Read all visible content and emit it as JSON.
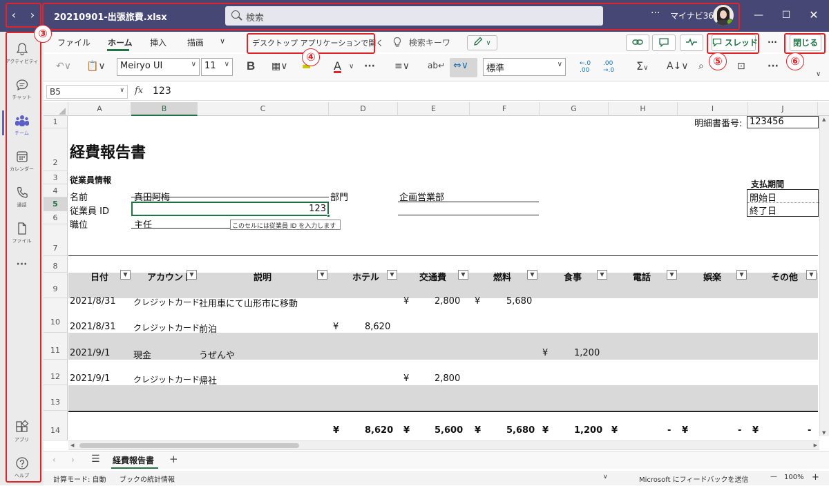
{
  "titlebar": {
    "file_name": "20210901-出張旅費.xlsx",
    "search_placeholder": "検索",
    "more": "···",
    "org": "マイナビ365"
  },
  "callouts": [
    "③",
    "④",
    "⑤",
    "⑥"
  ],
  "rail": [
    {
      "label": "アクティビティ",
      "icon": "bell-icon"
    },
    {
      "label": "チャット",
      "icon": "chat-icon"
    },
    {
      "label": "チーム",
      "icon": "teams-icon",
      "active": true
    },
    {
      "label": "カレンダー",
      "icon": "calendar-icon"
    },
    {
      "label": "通話",
      "icon": "phone-icon"
    },
    {
      "label": "ファイル",
      "icon": "file-icon"
    },
    {
      "label": "···",
      "icon": "more-icon"
    },
    {
      "label": "アプリ",
      "icon": "apps-icon"
    },
    {
      "label": "ヘルプ",
      "icon": "help-icon"
    }
  ],
  "ribbon": {
    "tabs": [
      "ファイル",
      "ホーム",
      "挿入",
      "描画",
      "∨"
    ],
    "open_desktop": "デスクトップ アプリケーションで開く",
    "search_keyword": "検索キーワ",
    "thread_label": "スレッド",
    "more": "···",
    "close_label": "閉じる"
  },
  "toolbar": {
    "font": "Meiryo UI",
    "size": "11",
    "bold": "B",
    "font_color": "A",
    "number_format": "標準",
    "dec_inc": "←.0\n.00",
    "dec_dec": ".00\n→.0",
    "sum": "Σ"
  },
  "formula": {
    "name_box": "B5",
    "fx": "fx",
    "value": "123"
  },
  "columns": [
    "A",
    "B",
    "C",
    "D",
    "E",
    "F",
    "G",
    "H",
    "I",
    "J"
  ],
  "rows": [
    "1",
    "2",
    "3",
    "4",
    "5",
    "6",
    "7",
    "8",
    "9",
    "10",
    "11",
    "12",
    "13",
    "14"
  ],
  "sheet": {
    "statement_label": "明細書番号:",
    "statement_no": "123456",
    "title": "経費報告書",
    "employee_info": "従業員情報",
    "name_label": "名前",
    "name_value": "真田阿梅",
    "dept_label": "部門",
    "dept_value": "企画営業部",
    "emp_id_label": "従業員 ID",
    "emp_id_value": "123",
    "position_label": "職位",
    "position_value": "主任",
    "tooltip": "このセルには従業員 ID を入力します",
    "pay_period": "支払期間",
    "start_date": "開始日",
    "end_date": "終了日"
  },
  "table": {
    "headers": [
      "日付",
      "アカウント",
      "説明",
      "ホテル",
      "交通費",
      "燃料",
      "食事",
      "電話",
      "娯楽",
      "その他"
    ],
    "rows": [
      {
        "date": "2021/8/31",
        "account": "クレジットカード",
        "desc": "社用車にて山形市に移動",
        "transport": "2,800",
        "fuel": "5,680"
      },
      {
        "date": "2021/8/31",
        "account": "クレジットカード",
        "desc": "前泊",
        "hotel": "8,620"
      },
      {
        "date": "2021/9/1",
        "account": "現金",
        "desc": "うぜんや",
        "meal": "1,200"
      },
      {
        "date": "2021/9/1",
        "account": "クレジットカード",
        "desc": "帰社",
        "transport": "2,800"
      }
    ],
    "currency": "¥",
    "totals": {
      "hotel": "8,620",
      "transport": "5,600",
      "fuel": "5,680",
      "meal": "1,200",
      "phone": "-",
      "ent": "-",
      "other": "-"
    }
  },
  "sheet_tabs": {
    "menu": "☰",
    "active_tab": "経費報告書",
    "add": "+"
  },
  "status": {
    "calc_mode": "計算モード: 自動",
    "workbook_stats": "ブックの統計情報",
    "feedback": "Microsoft にフィードバックを送信",
    "minus": "—",
    "zoom": "100%",
    "plus": "+"
  }
}
